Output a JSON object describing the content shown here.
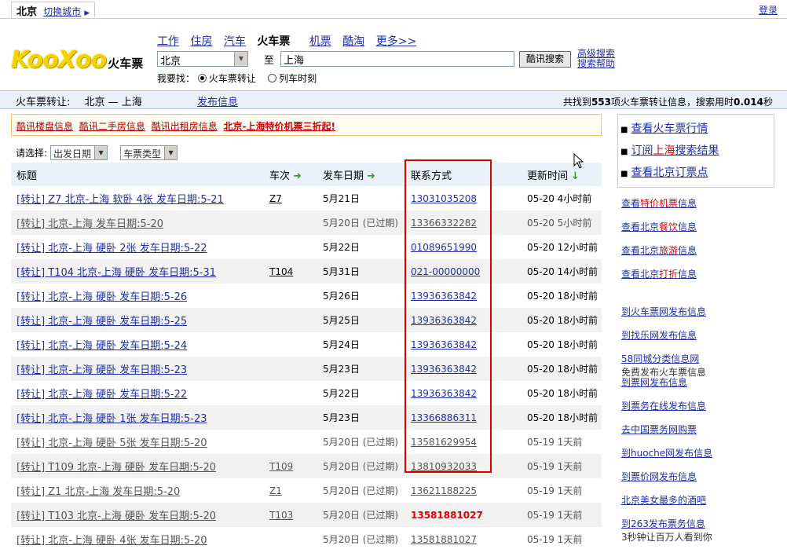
{
  "topbar": {
    "city": "北京",
    "switch_city": "切换城市",
    "login": "登录"
  },
  "logo": {
    "brand": "KooXoo",
    "sub": "火车票"
  },
  "nav": [
    "工作",
    "住房",
    "汽车",
    "火车票",
    "机票",
    "酷淘",
    "更多>>"
  ],
  "nav_active": "火车票",
  "search": {
    "from_value": "北京",
    "to_label": "至",
    "to_value": "上海",
    "button": "酷讯搜索",
    "advanced": "高级搜索",
    "help": "搜索帮助",
    "find_label": "我要找：",
    "option_transfer": "火车票转让",
    "option_timetable": "列车时刻"
  },
  "infobar": {
    "label": "火车票转让:",
    "route": "北京 — 上海",
    "publish": "发布信息",
    "summary_pre": "共找到",
    "count": "553",
    "summary_mid": "项火车票转让信息，搜索用时",
    "time": "0.014",
    "summary_post": "秒"
  },
  "ads": [
    "酷讯楼盘信息",
    "酷讯二手房信息",
    "酷讯出租房信息",
    "北京-上海特价机票三折起!"
  ],
  "filter": {
    "label": "请选择:",
    "date_select": "出发日期",
    "type_select": "车票类型"
  },
  "table": {
    "headers": [
      "标题",
      "车次",
      "发车日期",
      "联系方式",
      "更新时间"
    ],
    "rows": [
      {
        "title": "[转让] Z7 北京-上海 软卧 4张 发车日期:5-21",
        "train": "Z7",
        "date": "5月21日",
        "phone": "13031035208",
        "updated": "05-20 4小时前",
        "expired": false
      },
      {
        "title": "[转让] 北京-上海 发车日期:5-20",
        "train": "",
        "date": "5月20日 (已过期)",
        "phone": "13366332282",
        "updated": "05-20 5小时前",
        "expired": true
      },
      {
        "title": "[转让] 北京-上海 硬卧 2张 发车日期:5-22",
        "train": "",
        "date": "5月22日",
        "phone": "01089651990",
        "updated": "05-20 12小时前",
        "expired": false
      },
      {
        "title": "[转让] T104 北京-上海 硬卧 发车日期:5-31",
        "train": "T104",
        "date": "5月31日",
        "phone": "021-00000000",
        "updated": "05-20 14小时前",
        "expired": false
      },
      {
        "title": "[转让] 北京-上海 硬卧 发车日期:5-26",
        "train": "",
        "date": "5月26日",
        "phone": "13936363842",
        "updated": "05-20 18小时前",
        "expired": false
      },
      {
        "title": "[转让] 北京-上海 硬卧 发车日期:5-25",
        "train": "",
        "date": "5月25日",
        "phone": "13936363842",
        "updated": "05-20 18小时前",
        "expired": false
      },
      {
        "title": "[转让] 北京-上海 硬卧 发车日期:5-24",
        "train": "",
        "date": "5月24日",
        "phone": "13936363842",
        "updated": "05-20 18小时前",
        "expired": false
      },
      {
        "title": "[转让] 北京-上海 硬卧 发车日期:5-23",
        "train": "",
        "date": "5月23日",
        "phone": "13936363842",
        "updated": "05-20 18小时前",
        "expired": false
      },
      {
        "title": "[转让] 北京-上海 硬卧 发车日期:5-22",
        "train": "",
        "date": "5月22日",
        "phone": "13936363842",
        "updated": "05-20 18小时前",
        "expired": false
      },
      {
        "title": "[转让] 北京-上海 硬卧 1张 发车日期:5-23",
        "train": "",
        "date": "5月23日",
        "phone": "13366886311",
        "updated": "05-20 18小时前",
        "expired": false
      },
      {
        "title": "[转让] 北京-上海 硬卧 5张 发车日期:5-20",
        "train": "",
        "date": "5月20日 (已过期)",
        "phone": "13581629954",
        "updated": "05-19 1天前",
        "expired": true
      },
      {
        "title": "[转让] T109 北京-上海 硬卧 发车日期:5-20",
        "train": "T109",
        "date": "5月20日 (已过期)",
        "phone": "13810932033",
        "updated": "05-19 1天前",
        "expired": true
      },
      {
        "title": "[转让] Z1 北京-上海 发车日期:5-20",
        "train": "Z1",
        "date": "5月20日 (已过期)",
        "phone": "13621188225",
        "updated": "05-19 1天前",
        "expired": true
      },
      {
        "title": "[转让] T103 北京-上海 硬卧 发车日期:5-20",
        "train": "T103",
        "date": "5月20日 (已过期)",
        "phone": "13581881027",
        "updated": "05-19 1天前",
        "expired": true,
        "phone_highlight": true
      },
      {
        "title": "[转让] 北京-上海 硬卧 4张 发车日期:5-20",
        "train": "",
        "date": "5月20日 (已过期)",
        "phone": "13581881027",
        "updated": "05-19 1天前",
        "expired": true
      }
    ]
  },
  "sidebar": {
    "box_links": [
      {
        "pre": "查看火车票行情",
        "hl": "",
        "post": ""
      },
      {
        "pre": "订阅",
        "hl": "上海",
        "post": "搜索结果"
      },
      {
        "pre": "查看北京订票点",
        "hl": "",
        "post": ""
      }
    ],
    "links": [
      {
        "pre": "查看",
        "hl": "特价机票",
        "post": "信息"
      },
      {
        "pre": "查看北京",
        "hl": "餐饮",
        "post": "信息"
      },
      {
        "pre": "查看北京",
        "hl": "旅游",
        "post": "信息"
      },
      {
        "pre": "查看北京",
        "hl": "打折",
        "post": "信息"
      }
    ],
    "publish_links": [
      {
        "label": "到火车票网发布信息",
        "sub": ""
      },
      {
        "label": "到找乐网发布信息",
        "sub": ""
      },
      {
        "label": "58同城分类信息网",
        "sub": "免费发布火车票信息"
      },
      {
        "label": "到票网发布信息",
        "sub": ""
      },
      {
        "label": "到票务在线发布信息",
        "sub": ""
      },
      {
        "label": "去中国票务网购票",
        "sub": ""
      },
      {
        "label": "到huoche网发布信息",
        "sub": ""
      },
      {
        "label": "到票价网发布信息",
        "sub": ""
      },
      {
        "label": "北京美女最多的酒吧",
        "sub": ""
      },
      {
        "label": "到263发布票务信息",
        "sub": "3秒钟让百万人看到你"
      }
    ]
  },
  "colors": {
    "link": "#2030a0",
    "highlight_red": "#e00000",
    "header_bg": "#eaf1fa",
    "ad_border": "#f0c36d",
    "brand_yellow": "#f2d200"
  }
}
